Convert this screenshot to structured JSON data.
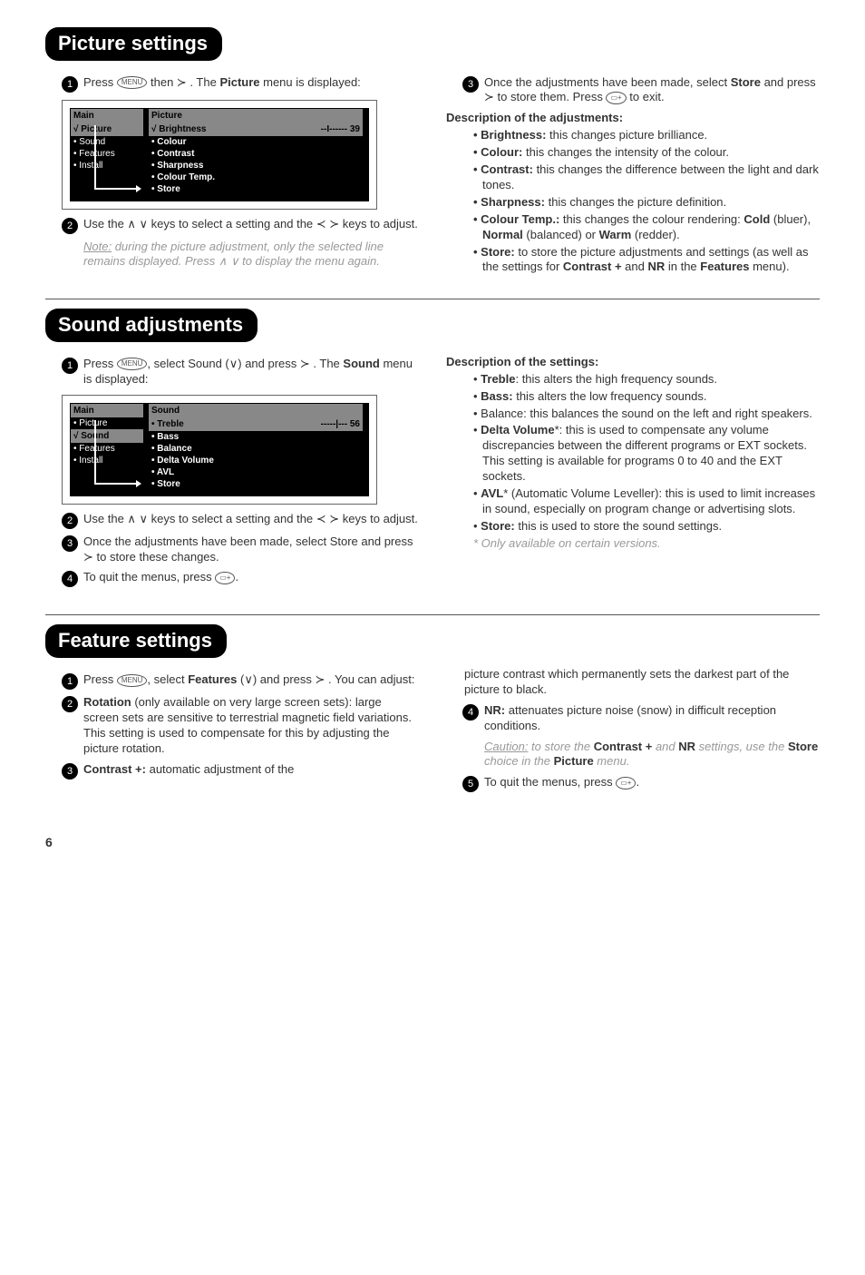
{
  "picture": {
    "heading": "Picture settings",
    "step1_a": "Press ",
    "step1_menu": "MENU",
    "step1_b": " then ≻ . The ",
    "step1_bold": "Picture",
    "step1_c": " menu is displayed:",
    "menu": {
      "left_title": "Main",
      "left_sel": "√ Picture",
      "left_items": [
        "• Sound",
        "• Features",
        "• Install"
      ],
      "right_title": "Picture",
      "right_sel_label": "√ Brightness",
      "right_sel_val": "--I------ 39",
      "right_items": [
        "• Colour",
        "• Contrast",
        "• Sharpness",
        "• Colour Temp.",
        "• Store"
      ]
    },
    "step2": "Use the ∧ ∨ keys to select a setting and the ≺ ≻ keys to adjust.",
    "note_a": "Note:",
    "note_b": " during the picture adjustment, only the selected line remains displayed. Press ∧ ∨ to display the menu again.",
    "step3_a": "Once the adjustments have been made, select ",
    "step3_bold": "Store",
    "step3_b": " and press ≻ to store them. Press ",
    "step3_oval": "▭+",
    "step3_c": " to exit.",
    "desc_title": "Description of the adjustments:",
    "desc": [
      {
        "b": "• Brightness:",
        "t": " this changes picture brilliance."
      },
      {
        "b": "• Colour:",
        "t": " this changes the intensity of the colour."
      },
      {
        "b": "• Contrast:",
        "t": " this changes the difference between the light and dark tones."
      },
      {
        "b": "• Sharpness:",
        "t": " this changes the picture definition."
      },
      {
        "b": "• Colour Temp.:",
        "t": " this changes the colour rendering: ",
        "b2": "Cold",
        "t2": " (bluer), ",
        "b3": "Normal",
        "t3": " (balanced) or ",
        "b4": "Warm",
        "t4": " (redder)."
      },
      {
        "b": "• Store:",
        "t": " to store the picture adjustments and settings (as well as the settings for ",
        "b2": "Contrast +",
        "t2": " and ",
        "b3": "NR",
        "t3": " in the ",
        "b4": "Features",
        "t4": " menu)."
      }
    ]
  },
  "sound": {
    "heading": "Sound adjustments",
    "step1_a": "Press ",
    "step1_menu": "MENU",
    "step1_b": ", select Sound (∨) and press ≻ . The ",
    "step1_bold": "Sound",
    "step1_c": " menu is displayed:",
    "menu": {
      "left_title": "Main",
      "left_items_pre": [
        "• Picture"
      ],
      "left_sel": "√ Sound",
      "left_items": [
        "• Features",
        "• Install"
      ],
      "right_title": "Sound",
      "right_sel_label": "• Treble",
      "right_sel_val": "-----|--- 56",
      "right_items": [
        "• Bass",
        "• Balance",
        "• Delta Volume",
        "• AVL",
        "• Store"
      ]
    },
    "step2": "Use the ∧ ∨ keys to select a setting and the ≺ ≻ keys to adjust.",
    "step3": "Once the adjustments have been made, select Store and press ≻ to store these changes.",
    "step4_a": "To quit the menus, press ",
    "step4_oval": "▭+",
    "step4_b": ".",
    "desc_title": "Description of the settings:",
    "desc": [
      {
        "b": "Treble",
        "t": ": this alters the high frequency sounds."
      },
      {
        "b": "Bass:",
        "t": " this alters the low frequency sounds."
      },
      {
        "t": "Balance: this balances the sound on the left and right speakers."
      },
      {
        "b": "Delta Volume",
        "s": "*",
        "t": ": this is used to compensate any volume discrepancies between the different programs or EXT sockets. This setting is available for programs 0 to 40 and the EXT sockets."
      },
      {
        "b": "AVL",
        "s": "*",
        "t": " (Automatic Volume Leveller): this is used to limit increases in sound, especially on program change or advertising slots."
      },
      {
        "b": "Store:",
        "t": " this is used to store the sound settings."
      }
    ],
    "footnote": "* Only available on certain versions."
  },
  "features": {
    "heading": "Feature settings",
    "step1_a": "Press ",
    "step1_menu": "MENU",
    "step1_b": ", select ",
    "step1_bold": "Features",
    "step1_c": " (∨) and press ≻ . You can adjust:",
    "step2_b": "Rotation",
    "step2_t": " (only available on very large screen sets): large screen sets are sensitive to terrestrial magnetic field variations. This setting is used to compensate for this by adjusting the picture rotation.",
    "step3_b": "Contrast +:",
    "step3_t": " automatic adjustment of the",
    "step3_cont": "picture contrast which permanently sets the darkest part of the picture to black.",
    "step4_b": "NR:",
    "step4_t": " attenuates picture noise (snow) in difficult reception conditions.",
    "caution_a": "Caution:",
    "caution_b": " to store the ",
    "caution_c": "Contrast +",
    "caution_d": " and ",
    "caution_e": "NR",
    "caution_f": " settings, use the ",
    "caution_g": "Store",
    "caution_h": " choice in the ",
    "caution_i": "Picture",
    "caution_j": " menu.",
    "step5_a": "To quit the menus, press ",
    "step5_oval": "▭+",
    "step5_b": "."
  },
  "page": "6"
}
